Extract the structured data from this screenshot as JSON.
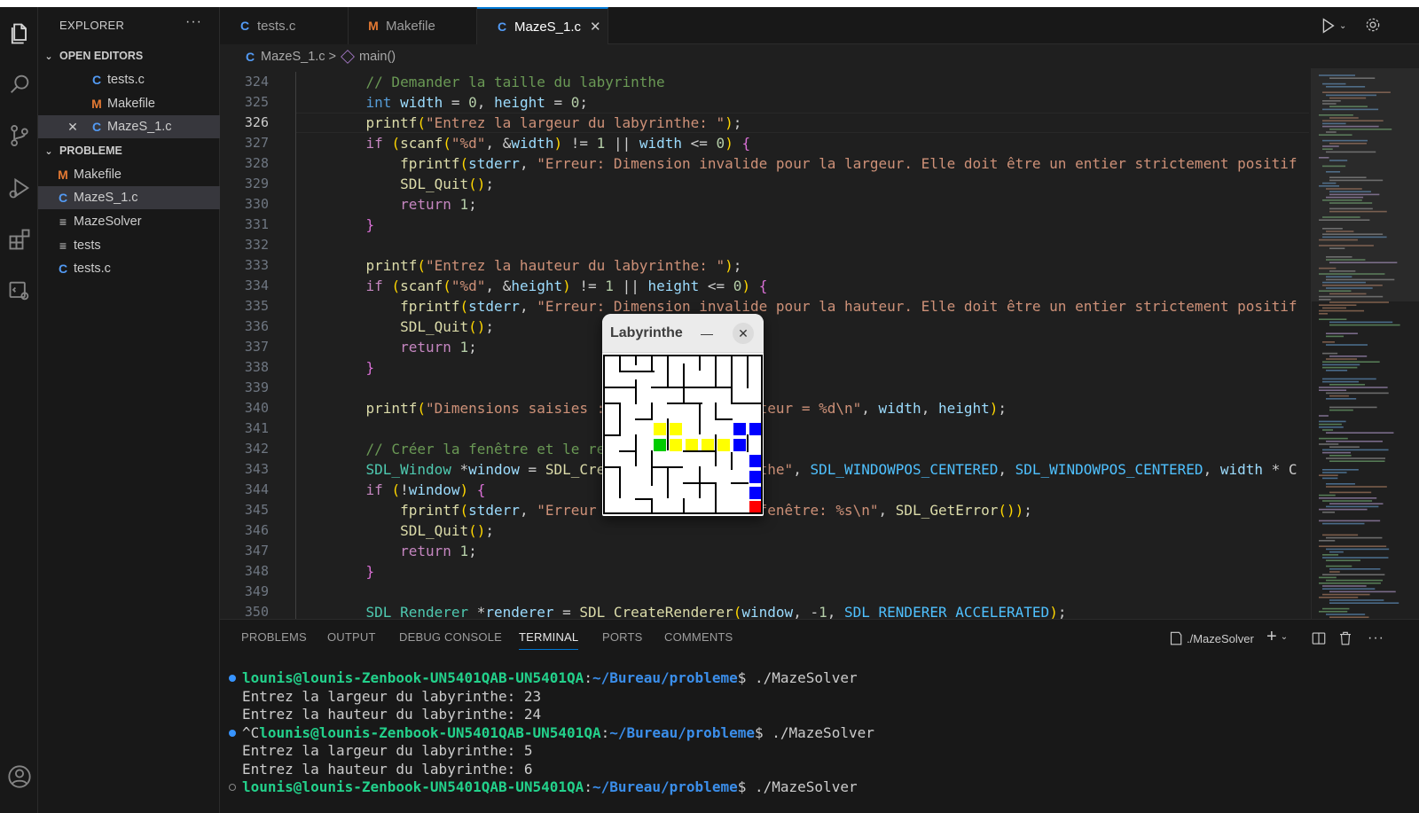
{
  "activity_bar": {
    "items": [
      {
        "name": "explorer-icon",
        "active": true
      },
      {
        "name": "search-icon"
      },
      {
        "name": "source-control-icon"
      },
      {
        "name": "run-debug-icon"
      },
      {
        "name": "extensions-icon"
      },
      {
        "name": "remote-explorer-icon"
      },
      {
        "name": "accounts-icon"
      }
    ]
  },
  "sidebar": {
    "title": "EXPLORER",
    "more": "···",
    "open_editors": {
      "label": "OPEN EDITORS",
      "items": [
        {
          "icon": "C",
          "label": "tests.c"
        },
        {
          "icon": "M",
          "label": "Makefile"
        },
        {
          "icon": "C",
          "label": "MazeS_1.c",
          "selected": true
        }
      ]
    },
    "folder": {
      "label": "PROBLEME",
      "items": [
        {
          "icon": "M",
          "label": "Makefile"
        },
        {
          "icon": "C",
          "label": "MazeS_1.c",
          "selected": true
        },
        {
          "icon": "≡",
          "label": "MazeSolver"
        },
        {
          "icon": "≡",
          "label": "tests"
        },
        {
          "icon": "C",
          "label": "tests.c"
        }
      ]
    }
  },
  "tabs": [
    {
      "icon": "C",
      "label": "tests.c"
    },
    {
      "icon": "M",
      "label": "Makefile"
    },
    {
      "icon": "C",
      "label": "MazeS_1.c",
      "active": true
    }
  ],
  "breadcrumb": {
    "icon": "C",
    "file": "MazeS_1.c",
    "sep": ">",
    "symbol": "main()"
  },
  "editor": {
    "current_line": 326,
    "line_numbers": [
      "324",
      "325",
      "326",
      "327",
      "328",
      "329",
      "330",
      "331",
      "332",
      "333",
      "334",
      "335",
      "336",
      "337",
      "338",
      "339",
      "340",
      "341",
      "342",
      "343",
      "344",
      "345",
      "346",
      "347",
      "348",
      "349",
      "350"
    ],
    "lines": [
      "    // Demander la taille du labyrinthe",
      "    int width = 0, height = 0;",
      "    printf(\"Entrez la largeur du labyrinthe: \");",
      "    if (scanf(\"%d\", &width) != 1 || width <= 0) {",
      "        fprintf(stderr, \"Erreur: Dimension invalide pour la largeur. Elle doit être un entier strictement positif",
      "        SDL_Quit();",
      "        return 1;",
      "    }",
      "",
      "    printf(\"Entrez la hauteur du labyrinthe: \");",
      "    if (scanf(\"%d\", &height) != 1 || height <= 0) {",
      "        fprintf(stderr, \"Erreur: Dimension invalide pour la hauteur. Elle doit être un entier strictement positif",
      "        SDL_Quit();",
      "        return 1;",
      "    }",
      "",
      "    printf(\"Dimensions saisies : largeur = %d, hauteur = %d\\n\", width, height);",
      "",
      "    // Créer la fenêtre et le rendu",
      "    SDL_Window *window = SDL_CreateWindow(\"Labyrinthe\", SDL_WINDOWPOS_CENTERED, SDL_WINDOWPOS_CENTERED, width * C",
      "    if (!window) {",
      "        fprintf(stderr, \"Erreur de création de la fenêtre: %s\\n\", SDL_GetError());",
      "        SDL_Quit();",
      "        return 1;",
      "    }",
      "",
      "    SDL_Renderer *renderer = SDL_CreateRenderer(window, -1, SDL_RENDERER_ACCELERATED);"
    ]
  },
  "panel": {
    "tabs": [
      "PROBLEMS",
      "OUTPUT",
      "DEBUG CONSOLE",
      "TERMINAL",
      "PORTS",
      "COMMENTS"
    ],
    "active_tab": "TERMINAL",
    "terminal_name": "./MazeSolver",
    "terminal": {
      "user_host": "lounis@lounis-Zenbook-UN5401QAB-UN5401QA",
      "path": "~/Bureau/probleme",
      "prompt_end": "$",
      "command": " ./MazeSolver",
      "ctrl_c": "^C",
      "out1a": "Entrez la largeur du labyrinthe: 23",
      "out1b": "Entrez la hauteur du labyrinthe: 24",
      "out2a": "Entrez la largeur du labyrinthe: 5",
      "out2b": "Entrez la hauteur du labyrinthe: 6"
    }
  },
  "sdl_window": {
    "title": "Labyrinthe",
    "minimize": "—",
    "close": "✕",
    "colors": {
      "wall": "#000000",
      "path": "#ffff00",
      "start": "#00cc00",
      "visited": "#0000ff",
      "end": "#ff0000"
    }
  },
  "colors": {
    "accent": "#0078d4",
    "editor_bg": "#1f1f1f",
    "sidebar_bg": "#181818"
  }
}
